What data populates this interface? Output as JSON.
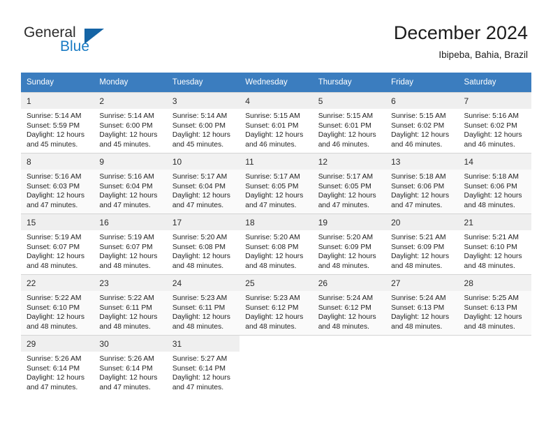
{
  "logo": {
    "text_top": "General",
    "text_bottom": "Blue",
    "triangle_color": "#1464a5",
    "blue_color": "#1a7bc4"
  },
  "header": {
    "title": "December 2024",
    "subtitle": "Ibipeba, Bahia, Brazil",
    "header_bg": "#3b7dbf"
  },
  "weekdays": [
    "Sunday",
    "Monday",
    "Tuesday",
    "Wednesday",
    "Thursday",
    "Friday",
    "Saturday"
  ],
  "weeks": [
    [
      {
        "day": "1",
        "sunrise": "Sunrise: 5:14 AM",
        "sunset": "Sunset: 5:59 PM",
        "daylight1": "Daylight: 12 hours",
        "daylight2": "and 45 minutes."
      },
      {
        "day": "2",
        "sunrise": "Sunrise: 5:14 AM",
        "sunset": "Sunset: 6:00 PM",
        "daylight1": "Daylight: 12 hours",
        "daylight2": "and 45 minutes."
      },
      {
        "day": "3",
        "sunrise": "Sunrise: 5:14 AM",
        "sunset": "Sunset: 6:00 PM",
        "daylight1": "Daylight: 12 hours",
        "daylight2": "and 45 minutes."
      },
      {
        "day": "4",
        "sunrise": "Sunrise: 5:15 AM",
        "sunset": "Sunset: 6:01 PM",
        "daylight1": "Daylight: 12 hours",
        "daylight2": "and 46 minutes."
      },
      {
        "day": "5",
        "sunrise": "Sunrise: 5:15 AM",
        "sunset": "Sunset: 6:01 PM",
        "daylight1": "Daylight: 12 hours",
        "daylight2": "and 46 minutes."
      },
      {
        "day": "6",
        "sunrise": "Sunrise: 5:15 AM",
        "sunset": "Sunset: 6:02 PM",
        "daylight1": "Daylight: 12 hours",
        "daylight2": "and 46 minutes."
      },
      {
        "day": "7",
        "sunrise": "Sunrise: 5:16 AM",
        "sunset": "Sunset: 6:02 PM",
        "daylight1": "Daylight: 12 hours",
        "daylight2": "and 46 minutes."
      }
    ],
    [
      {
        "day": "8",
        "sunrise": "Sunrise: 5:16 AM",
        "sunset": "Sunset: 6:03 PM",
        "daylight1": "Daylight: 12 hours",
        "daylight2": "and 47 minutes."
      },
      {
        "day": "9",
        "sunrise": "Sunrise: 5:16 AM",
        "sunset": "Sunset: 6:04 PM",
        "daylight1": "Daylight: 12 hours",
        "daylight2": "and 47 minutes."
      },
      {
        "day": "10",
        "sunrise": "Sunrise: 5:17 AM",
        "sunset": "Sunset: 6:04 PM",
        "daylight1": "Daylight: 12 hours",
        "daylight2": "and 47 minutes."
      },
      {
        "day": "11",
        "sunrise": "Sunrise: 5:17 AM",
        "sunset": "Sunset: 6:05 PM",
        "daylight1": "Daylight: 12 hours",
        "daylight2": "and 47 minutes."
      },
      {
        "day": "12",
        "sunrise": "Sunrise: 5:17 AM",
        "sunset": "Sunset: 6:05 PM",
        "daylight1": "Daylight: 12 hours",
        "daylight2": "and 47 minutes."
      },
      {
        "day": "13",
        "sunrise": "Sunrise: 5:18 AM",
        "sunset": "Sunset: 6:06 PM",
        "daylight1": "Daylight: 12 hours",
        "daylight2": "and 47 minutes."
      },
      {
        "day": "14",
        "sunrise": "Sunrise: 5:18 AM",
        "sunset": "Sunset: 6:06 PM",
        "daylight1": "Daylight: 12 hours",
        "daylight2": "and 48 minutes."
      }
    ],
    [
      {
        "day": "15",
        "sunrise": "Sunrise: 5:19 AM",
        "sunset": "Sunset: 6:07 PM",
        "daylight1": "Daylight: 12 hours",
        "daylight2": "and 48 minutes."
      },
      {
        "day": "16",
        "sunrise": "Sunrise: 5:19 AM",
        "sunset": "Sunset: 6:07 PM",
        "daylight1": "Daylight: 12 hours",
        "daylight2": "and 48 minutes."
      },
      {
        "day": "17",
        "sunrise": "Sunrise: 5:20 AM",
        "sunset": "Sunset: 6:08 PM",
        "daylight1": "Daylight: 12 hours",
        "daylight2": "and 48 minutes."
      },
      {
        "day": "18",
        "sunrise": "Sunrise: 5:20 AM",
        "sunset": "Sunset: 6:08 PM",
        "daylight1": "Daylight: 12 hours",
        "daylight2": "and 48 minutes."
      },
      {
        "day": "19",
        "sunrise": "Sunrise: 5:20 AM",
        "sunset": "Sunset: 6:09 PM",
        "daylight1": "Daylight: 12 hours",
        "daylight2": "and 48 minutes."
      },
      {
        "day": "20",
        "sunrise": "Sunrise: 5:21 AM",
        "sunset": "Sunset: 6:09 PM",
        "daylight1": "Daylight: 12 hours",
        "daylight2": "and 48 minutes."
      },
      {
        "day": "21",
        "sunrise": "Sunrise: 5:21 AM",
        "sunset": "Sunset: 6:10 PM",
        "daylight1": "Daylight: 12 hours",
        "daylight2": "and 48 minutes."
      }
    ],
    [
      {
        "day": "22",
        "sunrise": "Sunrise: 5:22 AM",
        "sunset": "Sunset: 6:10 PM",
        "daylight1": "Daylight: 12 hours",
        "daylight2": "and 48 minutes."
      },
      {
        "day": "23",
        "sunrise": "Sunrise: 5:22 AM",
        "sunset": "Sunset: 6:11 PM",
        "daylight1": "Daylight: 12 hours",
        "daylight2": "and 48 minutes."
      },
      {
        "day": "24",
        "sunrise": "Sunrise: 5:23 AM",
        "sunset": "Sunset: 6:11 PM",
        "daylight1": "Daylight: 12 hours",
        "daylight2": "and 48 minutes."
      },
      {
        "day": "25",
        "sunrise": "Sunrise: 5:23 AM",
        "sunset": "Sunset: 6:12 PM",
        "daylight1": "Daylight: 12 hours",
        "daylight2": "and 48 minutes."
      },
      {
        "day": "26",
        "sunrise": "Sunrise: 5:24 AM",
        "sunset": "Sunset: 6:12 PM",
        "daylight1": "Daylight: 12 hours",
        "daylight2": "and 48 minutes."
      },
      {
        "day": "27",
        "sunrise": "Sunrise: 5:24 AM",
        "sunset": "Sunset: 6:13 PM",
        "daylight1": "Daylight: 12 hours",
        "daylight2": "and 48 minutes."
      },
      {
        "day": "28",
        "sunrise": "Sunrise: 5:25 AM",
        "sunset": "Sunset: 6:13 PM",
        "daylight1": "Daylight: 12 hours",
        "daylight2": "and 48 minutes."
      }
    ],
    [
      {
        "day": "29",
        "sunrise": "Sunrise: 5:26 AM",
        "sunset": "Sunset: 6:14 PM",
        "daylight1": "Daylight: 12 hours",
        "daylight2": "and 47 minutes."
      },
      {
        "day": "30",
        "sunrise": "Sunrise: 5:26 AM",
        "sunset": "Sunset: 6:14 PM",
        "daylight1": "Daylight: 12 hours",
        "daylight2": "and 47 minutes."
      },
      {
        "day": "31",
        "sunrise": "Sunrise: 5:27 AM",
        "sunset": "Sunset: 6:14 PM",
        "daylight1": "Daylight: 12 hours",
        "daylight2": "and 47 minutes."
      },
      {
        "day": "",
        "sunrise": "",
        "sunset": "",
        "daylight1": "",
        "daylight2": ""
      },
      {
        "day": "",
        "sunrise": "",
        "sunset": "",
        "daylight1": "",
        "daylight2": ""
      },
      {
        "day": "",
        "sunrise": "",
        "sunset": "",
        "daylight1": "",
        "daylight2": ""
      },
      {
        "day": "",
        "sunrise": "",
        "sunset": "",
        "daylight1": "",
        "daylight2": ""
      }
    ]
  ]
}
